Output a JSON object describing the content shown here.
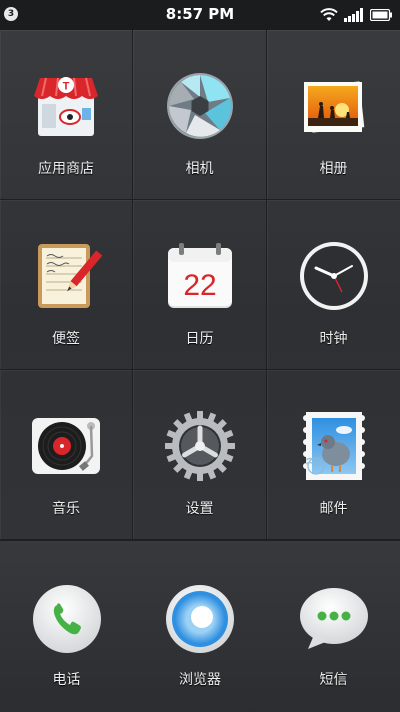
{
  "status_bar": {
    "notification_count": "3",
    "time": "8:57 PM",
    "icons": [
      "wifi-icon",
      "signal-icon",
      "battery-icon"
    ]
  },
  "apps": [
    {
      "label": "应用商店",
      "icon": "app-store-icon"
    },
    {
      "label": "相机",
      "icon": "camera-icon"
    },
    {
      "label": "相册",
      "icon": "gallery-icon"
    },
    {
      "label": "便签",
      "icon": "notes-icon"
    },
    {
      "label": "日历",
      "icon": "calendar-icon",
      "calendar_day": "22"
    },
    {
      "label": "时钟",
      "icon": "clock-icon"
    },
    {
      "label": "音乐",
      "icon": "music-icon"
    },
    {
      "label": "设置",
      "icon": "settings-icon"
    },
    {
      "label": "邮件",
      "icon": "mail-icon"
    }
  ],
  "dock": [
    {
      "label": "电话",
      "icon": "phone-icon"
    },
    {
      "label": "浏览器",
      "icon": "browser-icon"
    },
    {
      "label": "短信",
      "icon": "messages-icon"
    }
  ],
  "colors": {
    "background": "#34363a",
    "status_bar": "#1b1c1e",
    "accent_green": "#46b246",
    "accent_blue": "#2f8fe0",
    "accent_red": "#d8262b"
  }
}
